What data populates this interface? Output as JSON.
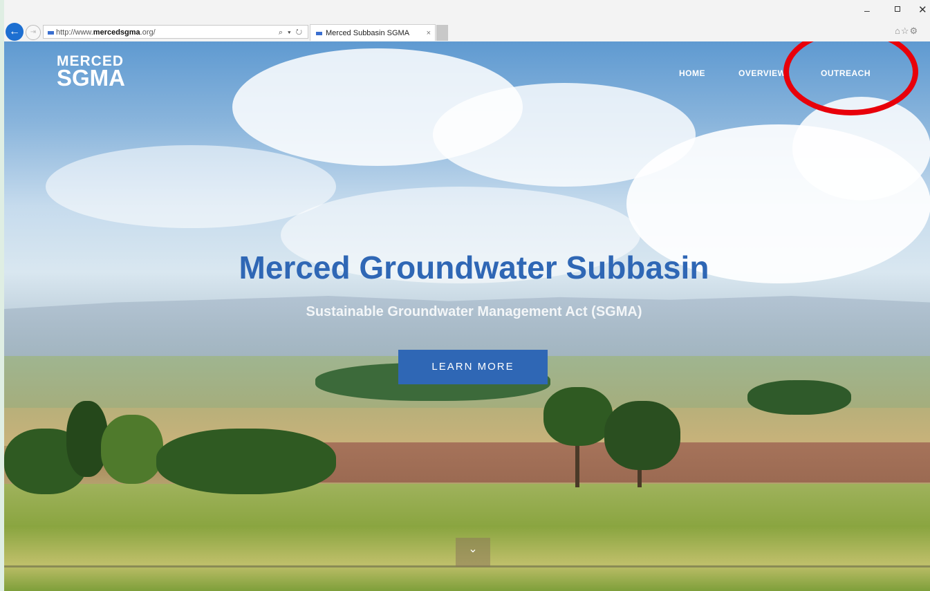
{
  "browser": {
    "url_prefix": "http://www.",
    "url_host": "mercedsgma",
    "url_suffix": ".org/",
    "address_tools": "⌕ ▾ ↻",
    "tab_title": "Merced Subbasin SGMA",
    "tab_close": "×",
    "back_glyph": "←",
    "forward_glyph": "⇥",
    "minimize_glyph": "–",
    "close_glyph": "✕",
    "toolbar_icons": "⌂☆⚙"
  },
  "site": {
    "logo_top": "MERCED",
    "logo_bottom": "SGMA",
    "nav": {
      "home": "HOME",
      "overview": "OVERVIEW",
      "outreach": "OUTREACH"
    },
    "hero_title": "Merced Groundwater Subbasin",
    "hero_subtitle": "Sustainable Groundwater Management Act (SGMA)",
    "cta_label": "LEARN MORE",
    "scroll_glyph": "⌄"
  },
  "annotation": {
    "highlight_color": "#e8000a",
    "highlight_target": "OUTREACH"
  },
  "colors": {
    "brand_blue": "#2f67b5",
    "browser_back": "#1d6fd1"
  }
}
